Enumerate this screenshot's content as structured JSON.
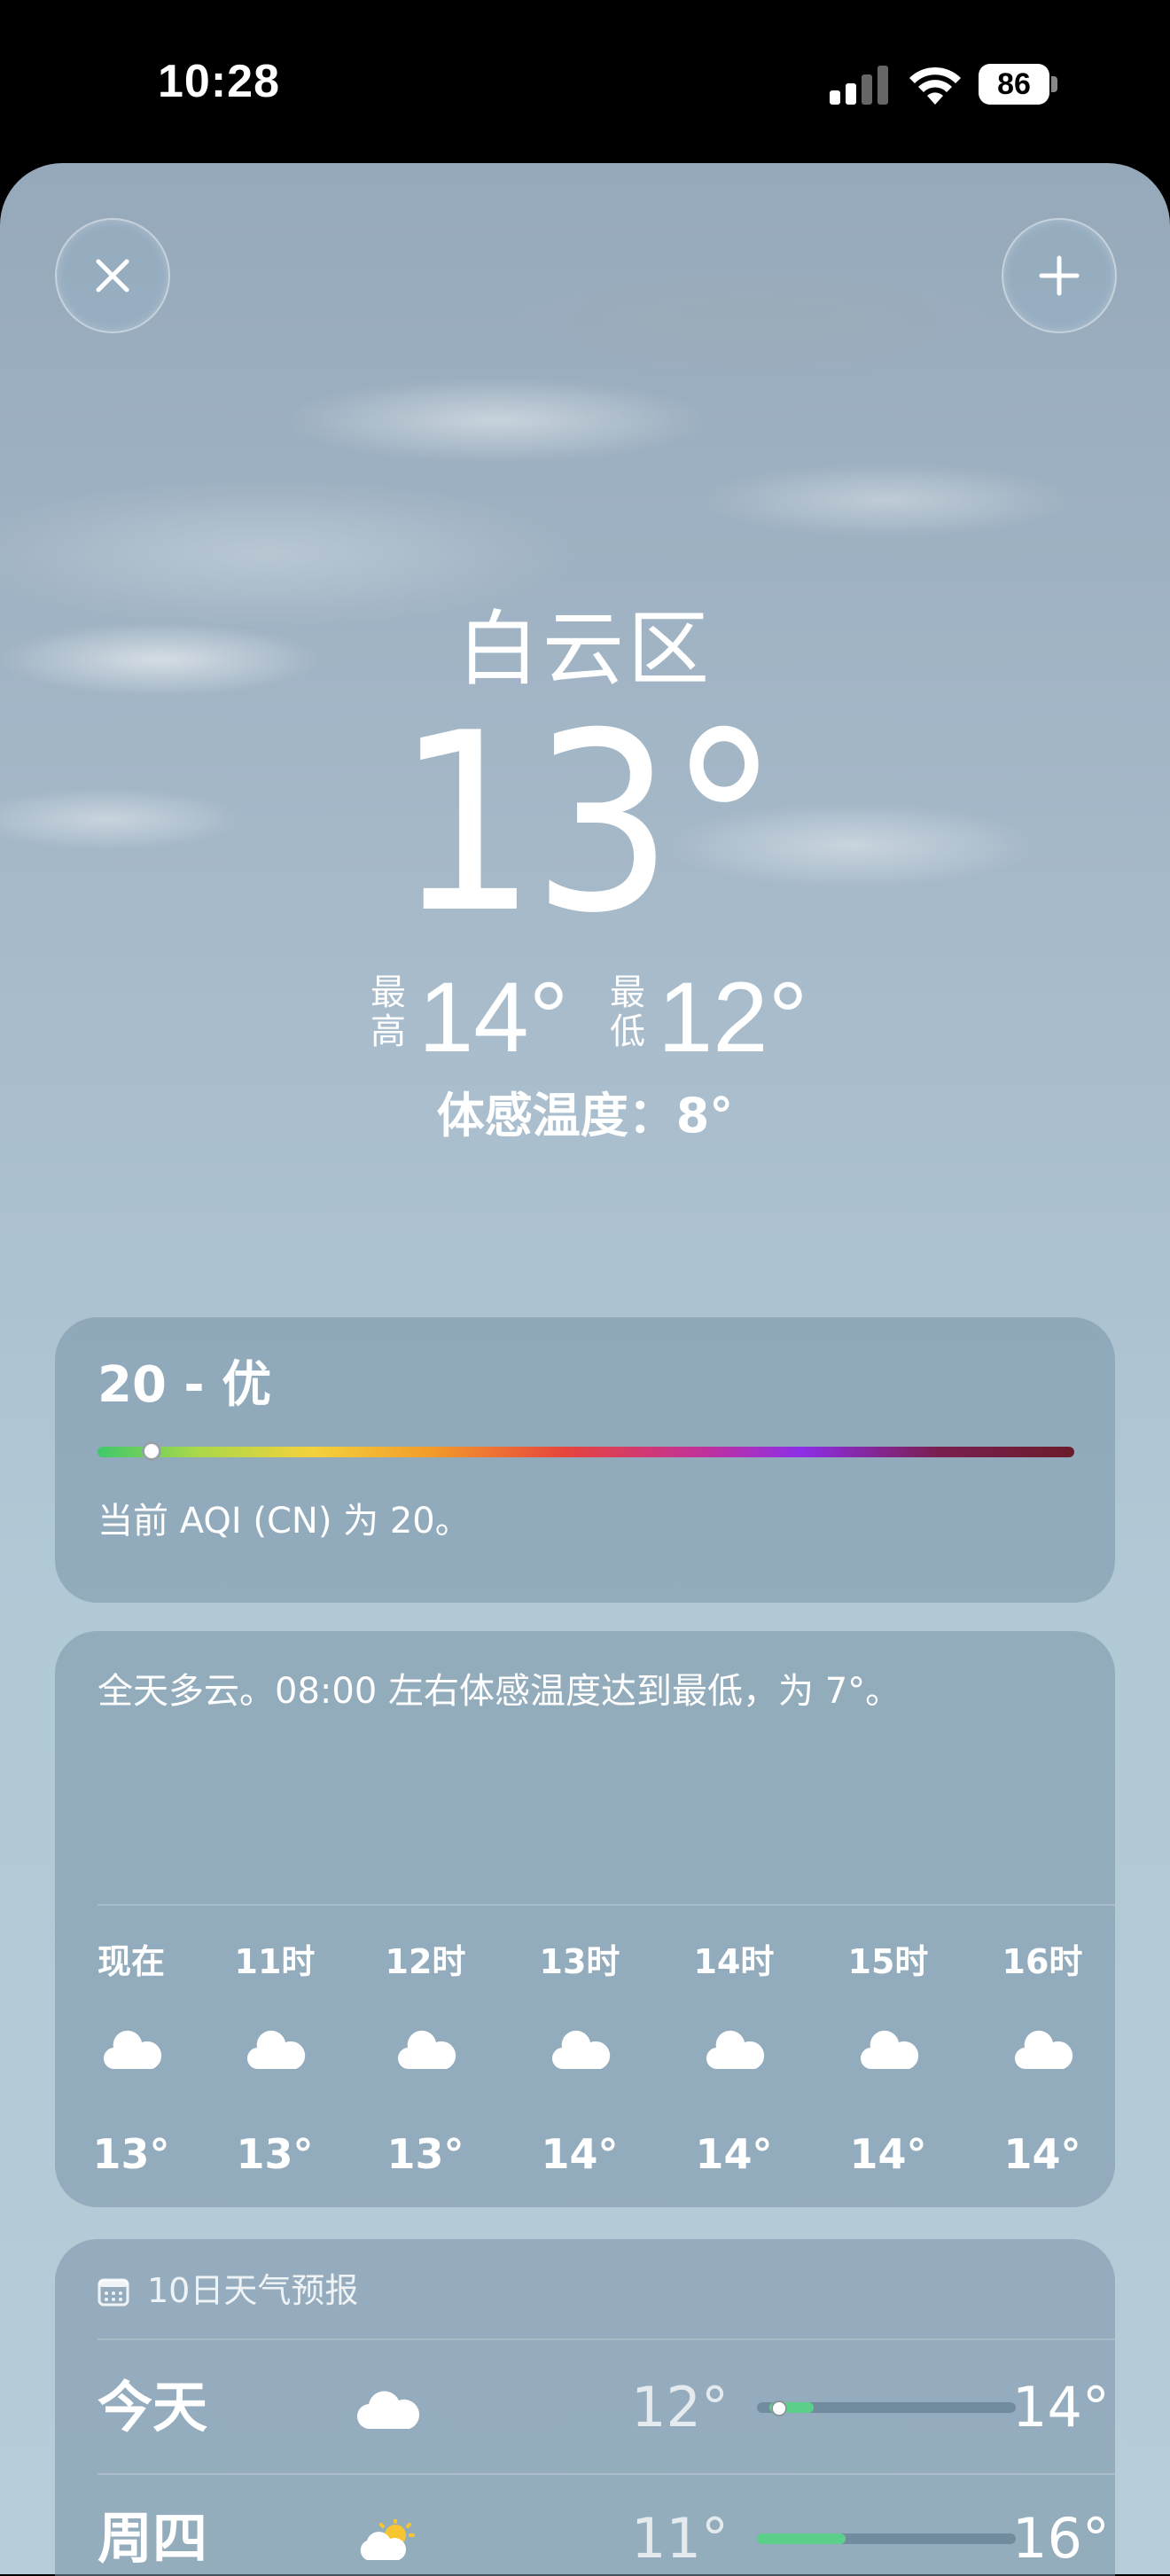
{
  "status_bar": {
    "time": "10:28",
    "battery": "86"
  },
  "location": {
    "city": "白云区",
    "temperature": "13°"
  },
  "hilo": {
    "high_label_1": "最",
    "high_label_2": "高",
    "high_value": "14°",
    "low_label_1": "最",
    "low_label_2": "低",
    "low_value": "12°"
  },
  "feels_like": "体感温度：8°",
  "aqi": {
    "value_label": "20 - 优",
    "value": 20,
    "description": "当前 AQI (CN) 为 20。"
  },
  "hourly": {
    "summary": "全天多云。08:00 左右体感温度达到最低，为 7°。",
    "items": [
      {
        "label": "现在",
        "icon": "cloud-icon",
        "temp": "13°"
      },
      {
        "label": "11时",
        "icon": "cloud-icon",
        "temp": "13°"
      },
      {
        "label": "12时",
        "icon": "cloud-icon",
        "temp": "13°"
      },
      {
        "label": "13时",
        "icon": "cloud-icon",
        "temp": "14°"
      },
      {
        "label": "14时",
        "icon": "cloud-icon",
        "temp": "14°"
      },
      {
        "label": "15时",
        "icon": "cloud-icon",
        "temp": "14°"
      },
      {
        "label": "16时",
        "icon": "cloud-icon",
        "temp": "14°"
      }
    ]
  },
  "forecast": {
    "header": "10日天气预报",
    "days": [
      {
        "day": "今天",
        "icon": "cloud-icon",
        "low": "12°",
        "high": "14°"
      },
      {
        "day": "周四",
        "icon": "partly-sunny-icon",
        "low": "11°",
        "high": "16°"
      }
    ]
  },
  "colors": {
    "aqi_good": "#3fc86b",
    "range_bar": "#5ccf8a"
  }
}
